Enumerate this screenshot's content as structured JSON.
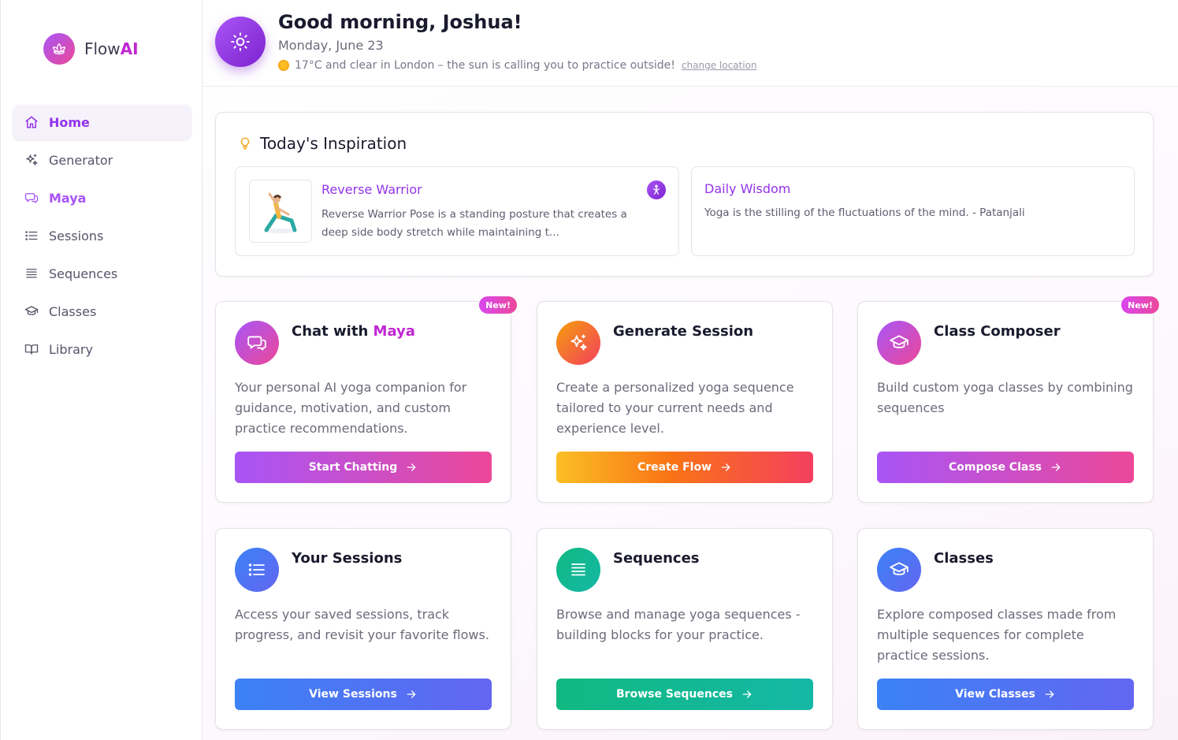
{
  "app": {
    "name_prefix": "Flow",
    "name_suffix": "AI"
  },
  "sidebar": {
    "items": [
      {
        "label": "Home",
        "icon": "home-icon"
      },
      {
        "label": "Generator",
        "icon": "sparkles-icon"
      },
      {
        "label": "Maya",
        "icon": "chat-icon"
      },
      {
        "label": "Sessions",
        "icon": "list-icon"
      },
      {
        "label": "Sequences",
        "icon": "stack-icon"
      },
      {
        "label": "Classes",
        "icon": "graduation-cap-icon"
      },
      {
        "label": "Library",
        "icon": "book-icon"
      }
    ],
    "active": "Home"
  },
  "header": {
    "greeting": "Good morning, Joshua!",
    "date": "Monday, June 23",
    "weather": "17°C and clear in London – the sun is calling you to practice outside!",
    "change_location": "change location"
  },
  "inspiration": {
    "title": "Today's Inspiration",
    "pose": {
      "name": "Reverse Warrior",
      "description": "Reverse Warrior Pose is a standing posture that creates a deep side body stretch while maintaining t..."
    },
    "wisdom": {
      "title": "Daily Wisdom",
      "text": "Yoga is the stilling of the fluctuations of the mind. - Patanjali"
    }
  },
  "cards": [
    {
      "title_prefix": "Chat with ",
      "title_accent": "Maya",
      "badge": "New!",
      "description": "Your personal AI yoga companion for guidance, motivation, and custom practice recommendations.",
      "button": "Start Chatting",
      "icon": "chat-icon"
    },
    {
      "title": "Generate Session",
      "description": "Create a personalized yoga sequence tailored to your current needs and experience level.",
      "button": "Create Flow",
      "icon": "sparkles-icon"
    },
    {
      "title": "Class Composer",
      "badge": "New!",
      "description": "Build custom yoga classes by combining sequences",
      "button": "Compose Class",
      "icon": "graduation-cap-icon"
    },
    {
      "title": "Your Sessions",
      "description": "Access your saved sessions, track progress, and revisit your favorite flows.",
      "button": "View Sessions",
      "icon": "list-icon"
    },
    {
      "title": "Sequences",
      "description": "Browse and manage yoga sequences - building blocks for your practice.",
      "button": "Browse Sequences",
      "icon": "stack-icon"
    },
    {
      "title": "Classes",
      "description": "Explore composed classes made from multiple sequences for complete practice sessions.",
      "button": "View Classes",
      "icon": "graduation-cap-icon"
    }
  ],
  "colors": {
    "brand_purple": "#9333ea",
    "brand_pink": "#ec4899",
    "blue": "#3b82f6",
    "green": "#10b981",
    "orange": "#f59e0b"
  }
}
